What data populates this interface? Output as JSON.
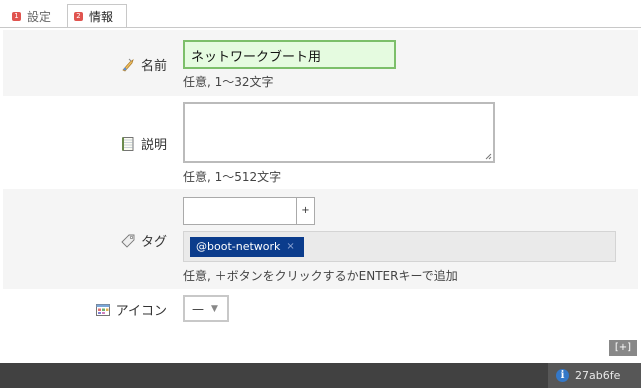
{
  "tabs": [
    {
      "number": "1",
      "label": "設定"
    },
    {
      "number": "2",
      "label": "情報"
    }
  ],
  "form": {
    "name": {
      "label": "名前",
      "value": "ネットワークブート用",
      "hint": "任意, 1〜32文字",
      "icon": "name-tag-icon"
    },
    "description": {
      "label": "説明",
      "value": "",
      "hint": "任意, 1〜512文字",
      "icon": "notebook-icon"
    },
    "tags": {
      "label": "タグ",
      "add_button": "+",
      "items": [
        "@boot-network"
      ],
      "remove_glyph": "×",
      "hint": "任意, ＋ボタンをクリックするかENTERキーで追加",
      "icon": "tag-icon"
    },
    "icon_field": {
      "label": "アイコン",
      "selected": "—",
      "icon": "icon-picker-icon"
    }
  },
  "expand_button": "[+]",
  "status": {
    "id": "27ab6fe",
    "info_glyph": "i"
  },
  "colors": {
    "tab_number": "#e0544f",
    "chip": "#0b3c8c",
    "name_field_bg": "#e5fbe0",
    "name_field_border": "#7cbf6a",
    "status_bar": "#414141",
    "info_icon": "#3478c8"
  }
}
